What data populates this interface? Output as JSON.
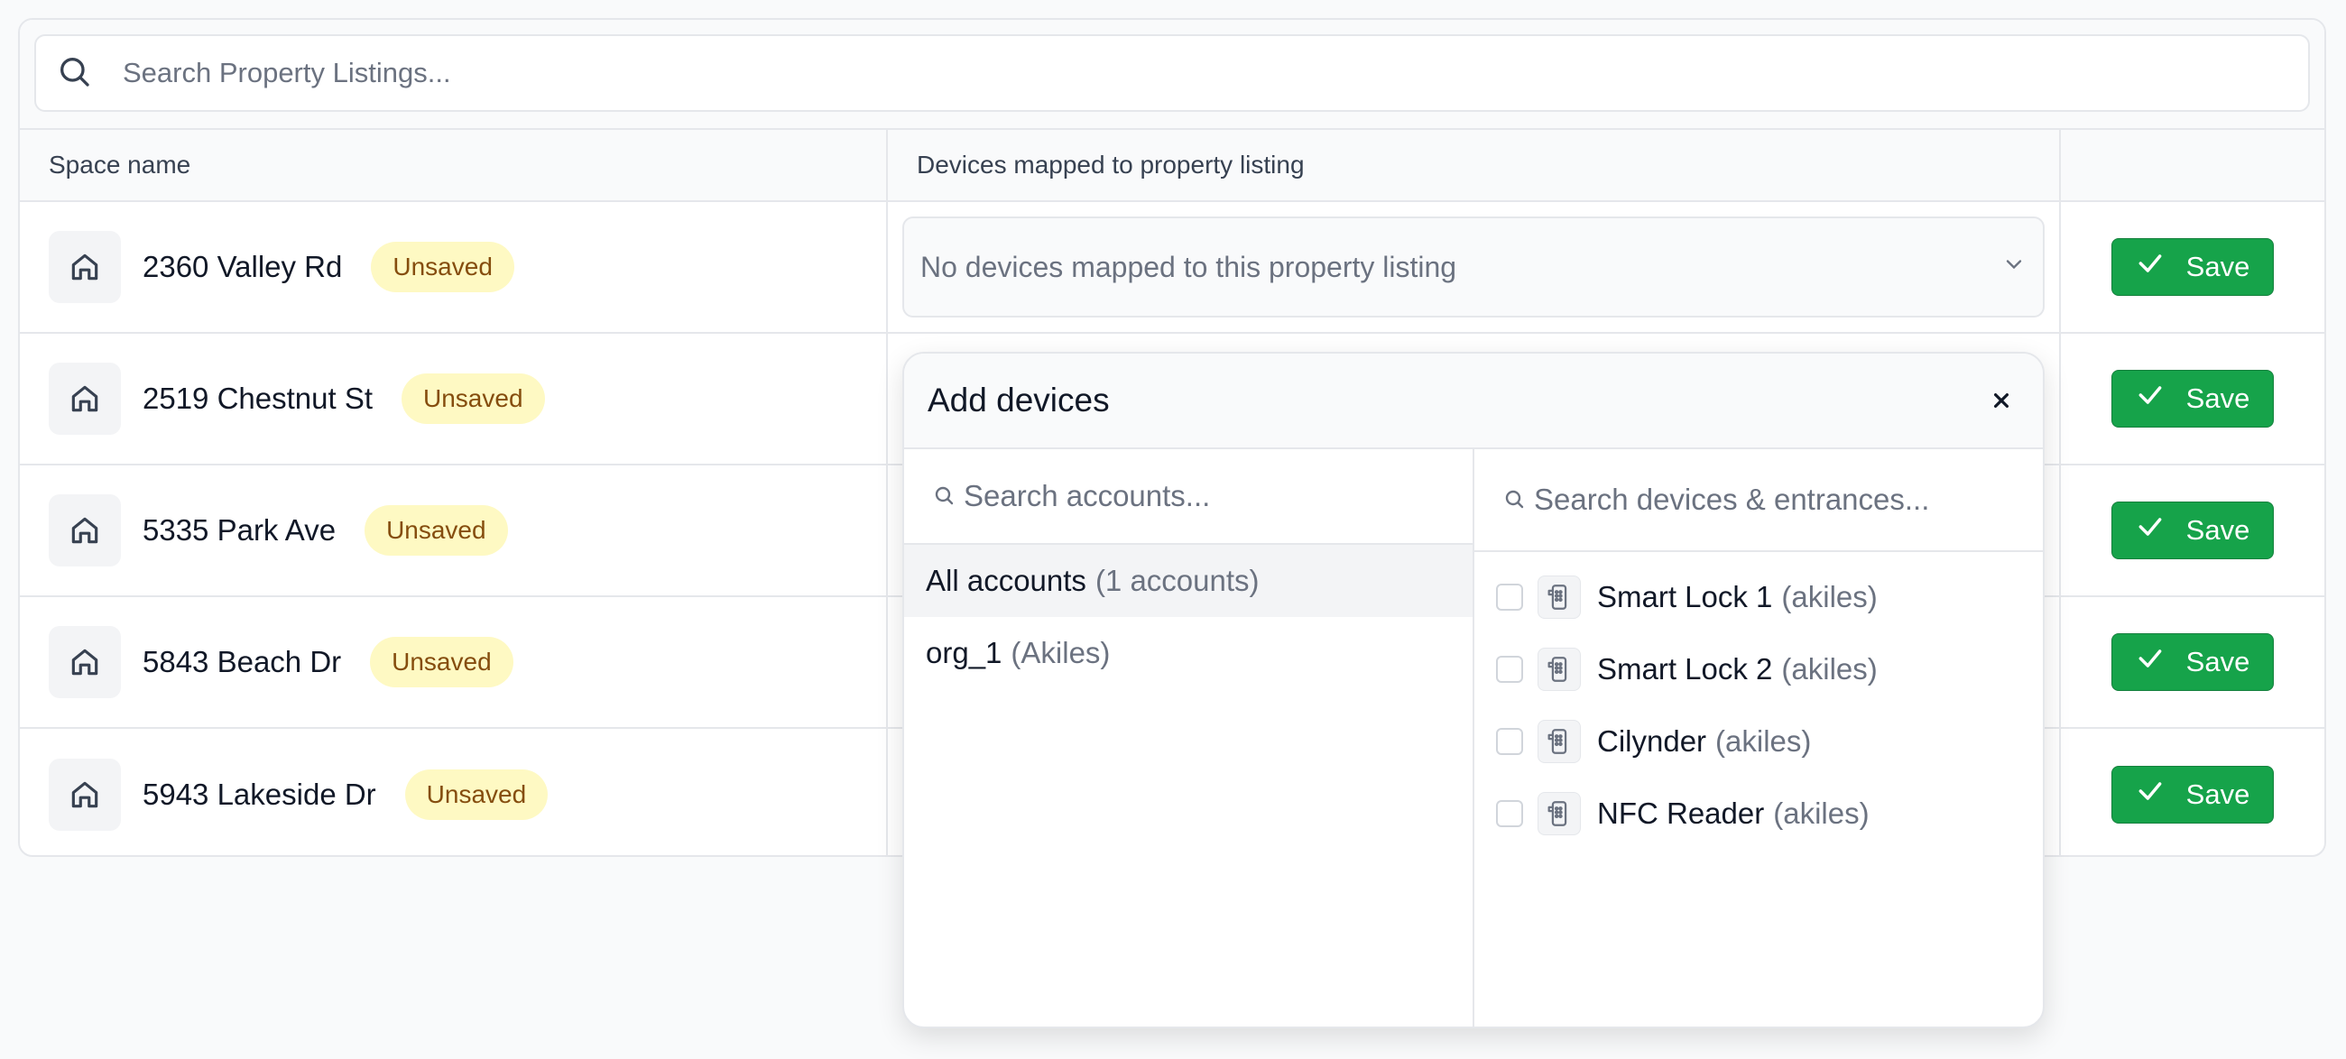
{
  "search": {
    "placeholder": "Search Property Listings..."
  },
  "table": {
    "headers": {
      "space_name": "Space name",
      "devices": "Devices mapped to property listing"
    },
    "rows": [
      {
        "name": "2360 Valley Rd",
        "badge": "Unsaved",
        "save_label": "Save"
      },
      {
        "name": "2519 Chestnut St",
        "badge": "Unsaved",
        "save_label": "Save"
      },
      {
        "name": "5335 Park Ave",
        "badge": "Unsaved",
        "save_label": "Save"
      },
      {
        "name": "5843 Beach Dr",
        "badge": "Unsaved",
        "save_label": "Save"
      },
      {
        "name": "5943 Lakeside Dr",
        "badge": "Unsaved",
        "save_label": "Save"
      }
    ],
    "first_row_select_placeholder": "No devices mapped to this property listing"
  },
  "popover": {
    "title": "Add devices",
    "accounts_search_placeholder": "Search accounts...",
    "devices_search_placeholder": "Search devices & entrances...",
    "accounts": [
      {
        "name": "All accounts",
        "meta": "(1 accounts)"
      },
      {
        "name": "org_1",
        "meta": "(Akiles)"
      }
    ],
    "devices": [
      {
        "name": "Smart Lock 1",
        "meta": "(akiles)"
      },
      {
        "name": "Smart Lock 2",
        "meta": "(akiles)"
      },
      {
        "name": "Cilynder",
        "meta": "(akiles)"
      },
      {
        "name": "NFC Reader",
        "meta": "(akiles)"
      }
    ]
  },
  "colors": {
    "save_green": "#16a34a",
    "badge_bg": "#fef9c3",
    "badge_text": "#854d0e"
  }
}
